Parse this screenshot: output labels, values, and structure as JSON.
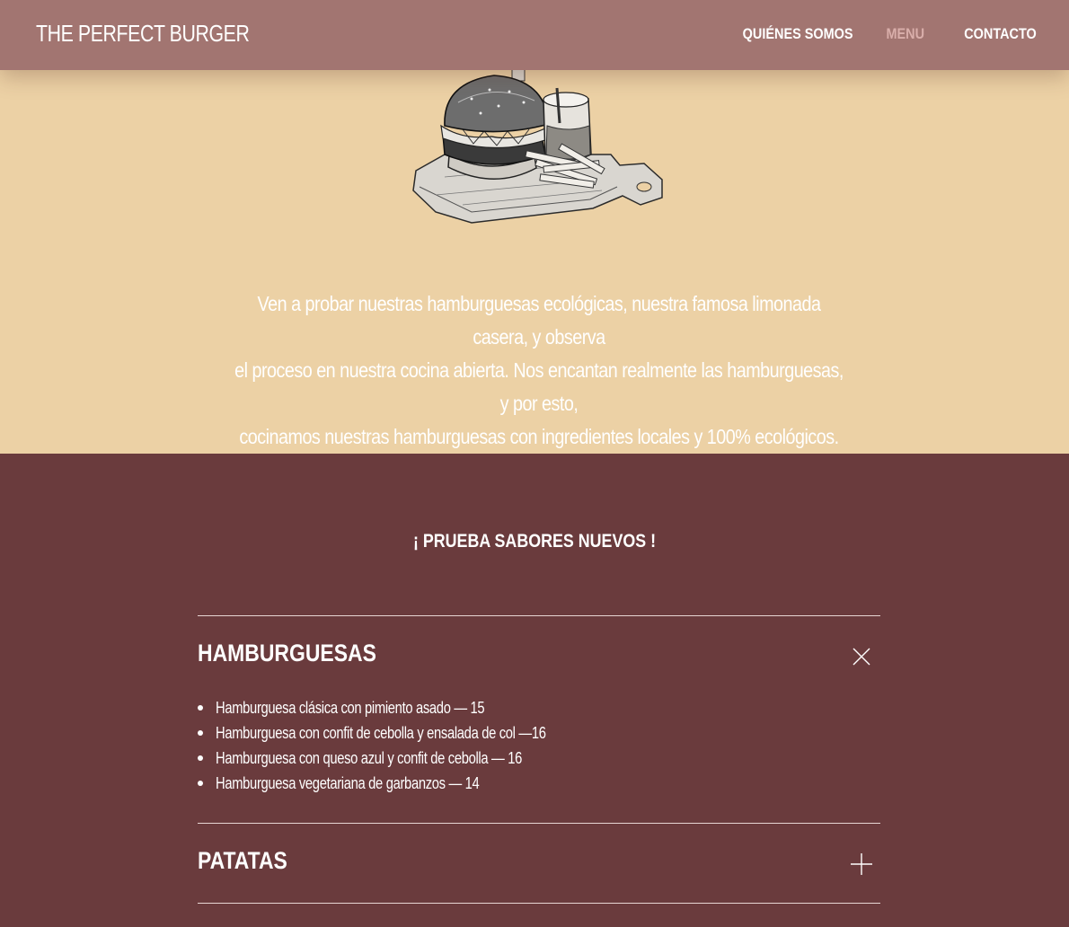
{
  "header": {
    "brand": "THE PERFECT BURGER",
    "nav": [
      {
        "label": "QUIÉNES SOMOS",
        "active": false
      },
      {
        "label": "MENU",
        "active": true
      },
      {
        "label": "CONTACTO",
        "active": false
      }
    ]
  },
  "hero": {
    "illustration": "burger-board-icon",
    "lines": [
      "Ven a probar nuestras hamburguesas ecológicas, nuestra famosa limonada casera, y observa",
      "el proceso en nuestra cocina abierta. Nos encantan realmente las hamburguesas, y por esto,",
      "cocinamos nuestras hamburguesas con ingredientes locales y 100% ecológicos."
    ]
  },
  "menu": {
    "heading": "¡ PRUEBA SABORES NUEVOS !",
    "sections": [
      {
        "title": "HAMBURGUESAS",
        "expanded": true,
        "icon": "close-icon",
        "items": [
          "Hamburguesa clásica con pimiento asado — 15",
          "Hamburguesa con confit de cebolla y ensalada de col —16",
          "Hamburguesa con queso azul y confit de cebolla — 16",
          "Hamburguesa vegetariana de garbanzos — 14"
        ]
      },
      {
        "title": "PATATAS",
        "expanded": false,
        "icon": "plus-icon",
        "items": []
      }
    ]
  },
  "colors": {
    "nav_bg": "#a27571",
    "nav_active": "#d9aeaa",
    "hero_bg": "#ecd1a5",
    "menu_bg": "#6a3b3d",
    "text": "#ffffff"
  }
}
